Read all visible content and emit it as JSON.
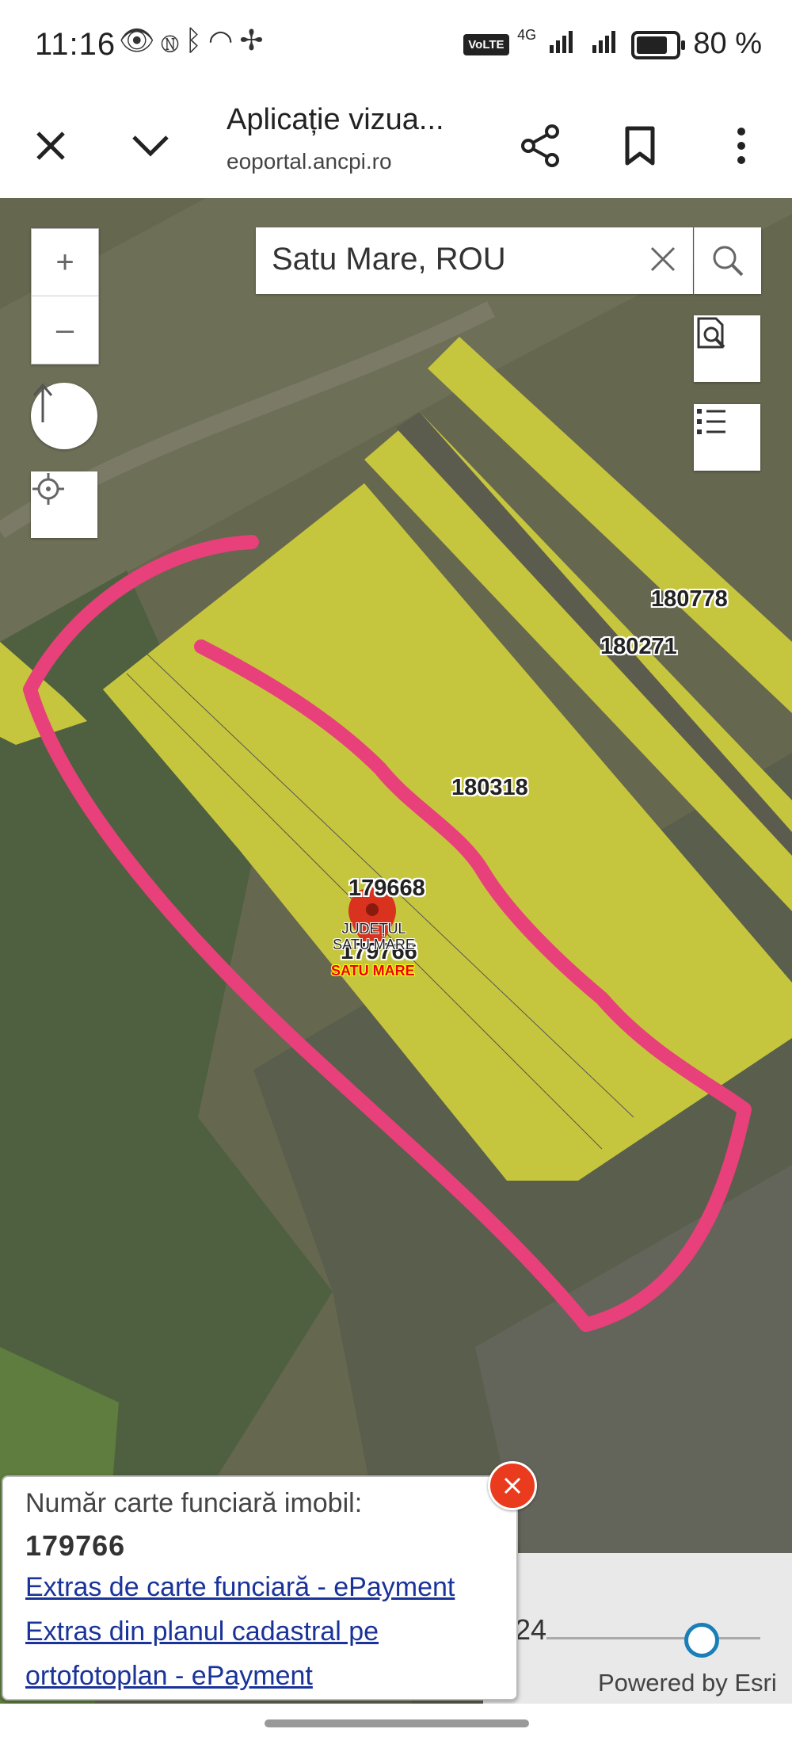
{
  "status_bar": {
    "time": "11:16",
    "network": "4G",
    "battery": "80 %",
    "icons": [
      "eye-icon",
      "nfc-icon",
      "bluetooth-icon",
      "hotspot-icon",
      "fan-icon",
      "volte-icon",
      "signal-icon",
      "battery-icon"
    ]
  },
  "browser": {
    "title": "Aplicație vizua...",
    "url": "eoportal.ancpi.ro",
    "close_icon": "close-icon",
    "collapse_icon": "chevron-down-icon",
    "share_icon": "share-icon",
    "bookmark_icon": "bookmark-icon",
    "menu_icon": "more-vert-icon"
  },
  "map": {
    "search": {
      "value": "Satu Mare, ROU"
    },
    "zoom_in": "+",
    "zoom_out": "–",
    "parcels": {
      "p1": "180778",
      "p2": "180271",
      "p3": "180318",
      "p4": "179668",
      "p5": "179766"
    },
    "county": {
      "line1": "JUDEȚUL",
      "line2": "SATU MARE",
      "line3": "SATU MARE"
    },
    "colors": {
      "parcel": "#c6c63e",
      "marker": "#d9321e",
      "highlight": "#e8407a"
    }
  },
  "popup": {
    "title": "Număr carte funciară imobil:",
    "value": "179766",
    "link1": "Extras de carte funciară - ePayment",
    "link2_line1": "Extras din planul cadastral pe",
    "link2_line2": "ortofotoplan - ePayment"
  },
  "footer": {
    "scale_fragment": "24",
    "powered_by": "Powered by Esri"
  }
}
